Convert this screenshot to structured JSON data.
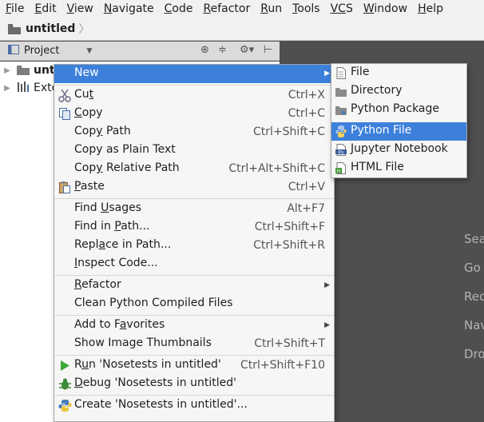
{
  "menubar": {
    "items": [
      {
        "mn": "F",
        "rest": "ile"
      },
      {
        "mn": "E",
        "rest": "dit"
      },
      {
        "mn": "V",
        "rest": "iew"
      },
      {
        "mn": "N",
        "rest": "avigate"
      },
      {
        "mn": "C",
        "rest": "ode"
      },
      {
        "mn": "R",
        "rest": "efactor"
      },
      {
        "mn": "R",
        "rest": "un"
      },
      {
        "mn": "T",
        "rest": "ools"
      },
      {
        "mn": "VC",
        "rest": "S"
      },
      {
        "mn": "W",
        "rest": "indow"
      },
      {
        "mn": "H",
        "rest": "elp"
      }
    ]
  },
  "breadcrumb": {
    "label": "untitled"
  },
  "project_toolbar": {
    "label": "Project"
  },
  "tree": {
    "row1": "unti",
    "row2": "Exte"
  },
  "right_panel": {
    "lines": [
      "Sea",
      "Go",
      "Rec",
      "Nav",
      "Dro"
    ]
  },
  "context_menu": {
    "new": {
      "label": "New"
    },
    "cut": {
      "pre": "Cu",
      "mn": "t",
      "post": "",
      "shortcut": "Ctrl+X"
    },
    "copy": {
      "pre": "",
      "mn": "C",
      "post": "opy",
      "shortcut": "Ctrl+C"
    },
    "copy_path": {
      "pre": "Cop",
      "mn": "y",
      "post": " Path",
      "shortcut": "Ctrl+Shift+C"
    },
    "copy_plain": {
      "label": "Copy as Plain Text"
    },
    "copy_relative": {
      "pre": "Cop",
      "mn": "y",
      "post": " Relative Path",
      "shortcut": "Ctrl+Alt+Shift+C"
    },
    "paste": {
      "pre": "",
      "mn": "P",
      "post": "aste",
      "shortcut": "Ctrl+V"
    },
    "find_usages": {
      "pre": "Find ",
      "mn": "U",
      "post": "sages",
      "shortcut": "Alt+F7"
    },
    "find_in_path": {
      "pre": "Find in ",
      "mn": "P",
      "post": "ath...",
      "shortcut": "Ctrl+Shift+F"
    },
    "replace_in_path": {
      "pre": "Repl",
      "mn": "a",
      "post": "ce in Path...",
      "shortcut": "Ctrl+Shift+R"
    },
    "inspect_code": {
      "pre": "",
      "mn": "I",
      "post": "nspect Code..."
    },
    "refactor": {
      "pre": "",
      "mn": "R",
      "post": "efactor"
    },
    "clean_compiled": {
      "label": "Clean Python Compiled Files"
    },
    "add_favorites": {
      "pre": "Add to F",
      "mn": "a",
      "post": "vorites"
    },
    "show_thumbnails": {
      "label": "Show Image Thumbnails",
      "shortcut": "Ctrl+Shift+T"
    },
    "run": {
      "pre": "R",
      "mn": "u",
      "post": "n 'Nosetests in untitled'",
      "shortcut": "Ctrl+Shift+F10"
    },
    "debug": {
      "pre": "",
      "mn": "D",
      "post": "ebug 'Nosetests in untitled'"
    },
    "create": {
      "label": "Create 'Nosetests in untitled'..."
    }
  },
  "new_submenu": {
    "items": [
      "File",
      "Directory",
      "Python Package",
      "Python File",
      "Jupyter Notebook",
      "HTML File"
    ]
  },
  "colors": {
    "highlight": "#3d80db",
    "menu_bg": "#f6f6f5",
    "panel_bg": "#4f4f4f"
  }
}
